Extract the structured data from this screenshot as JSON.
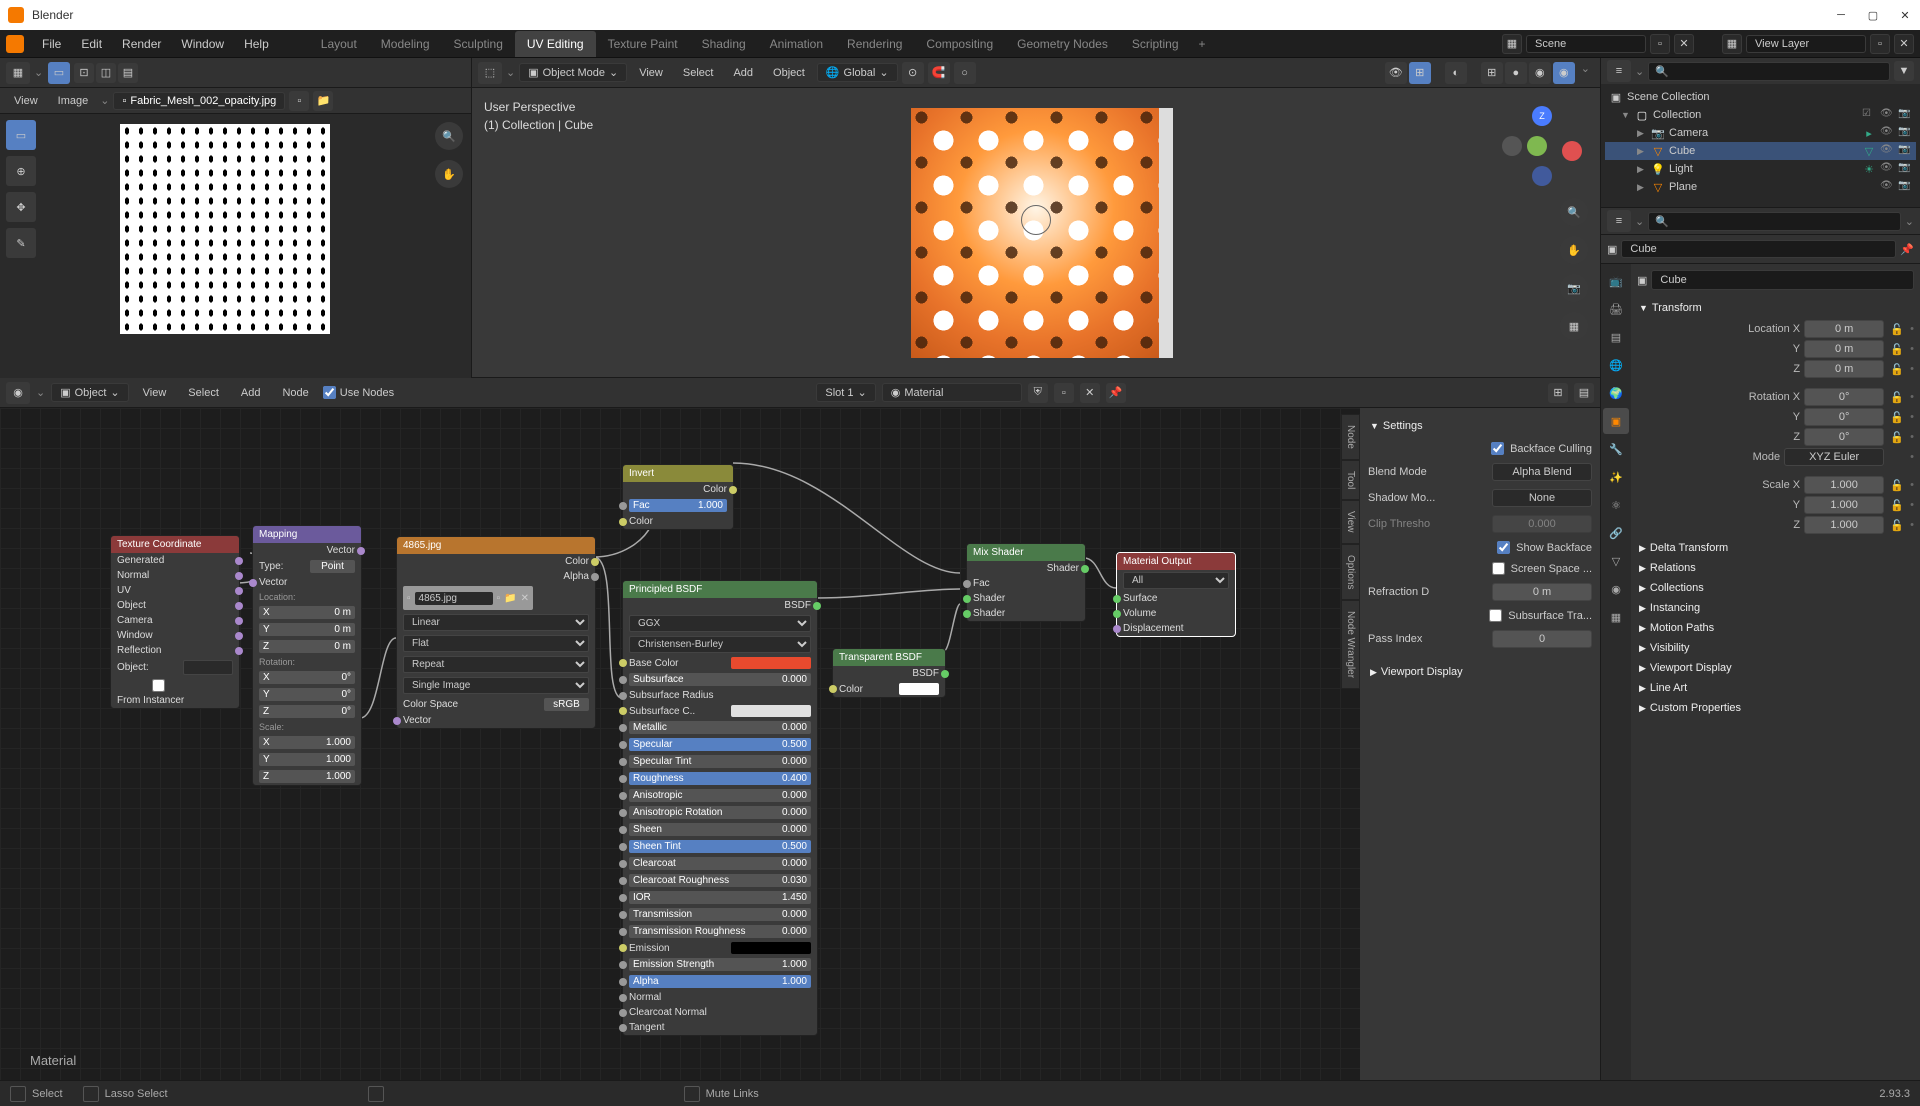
{
  "app": {
    "title": "Blender"
  },
  "topmenu": {
    "items": [
      "File",
      "Edit",
      "Render",
      "Window",
      "Help"
    ],
    "workspaces": [
      "Layout",
      "Modeling",
      "Sculpting",
      "UV Editing",
      "Texture Paint",
      "Shading",
      "Animation",
      "Rendering",
      "Compositing",
      "Geometry Nodes",
      "Scripting"
    ],
    "active_workspace": "UV Editing",
    "scene_label": "Scene",
    "layer_label": "View Layer"
  },
  "uv": {
    "menus": [
      "View",
      "Image"
    ],
    "image_name": "Fabric_Mesh_002_opacity.jpg"
  },
  "viewport": {
    "menus": [
      "View",
      "Select",
      "Add",
      "Object"
    ],
    "mode": "Object Mode",
    "orientation": "Global",
    "info_line1": "User Perspective",
    "info_line2": "(1) Collection | Cube"
  },
  "shader": {
    "menus": [
      "View",
      "Select",
      "Add",
      "Node"
    ],
    "object_label": "Object",
    "use_nodes": "Use Nodes",
    "slot": "Slot 1",
    "material": "Material",
    "material_label": "Material"
  },
  "nodes": {
    "texcoord": {
      "title": "Texture Coordinate",
      "outputs": [
        "Generated",
        "Normal",
        "UV",
        "Object",
        "Camera",
        "Window",
        "Reflection"
      ],
      "object_label": "Object:",
      "instancer": "From Instancer"
    },
    "mapping": {
      "title": "Mapping",
      "type_label": "Type:",
      "type": "Point",
      "vector": "Vector",
      "location": "Location:",
      "rotation": "Rotation:",
      "scale": "Scale:",
      "loc": {
        "x": "0 m",
        "y": "0 m",
        "z": "0 m"
      },
      "rot": {
        "x": "0°",
        "y": "0°",
        "z": "0°"
      },
      "scl": {
        "x": "1.000",
        "y": "1.000",
        "z": "1.000"
      }
    },
    "image": {
      "title": "4865.jpg",
      "name": "4865.jpg",
      "outputs": {
        "color": "Color",
        "alpha": "Alpha"
      },
      "interp": "Linear",
      "proj": "Flat",
      "ext": "Repeat",
      "src": "Single Image",
      "cs_label": "Color Space",
      "cs": "sRGB",
      "vector": "Vector"
    },
    "invert": {
      "title": "Invert",
      "color_out": "Color",
      "fac": "Fac",
      "fac_val": "1.000",
      "color_in": "Color"
    },
    "bsdf": {
      "title": "Principled BSDF",
      "out": "BSDF",
      "dist": "GGX",
      "sss": "Christensen-Burley",
      "rows": [
        {
          "k": "Base Color",
          "v": "",
          "swatch": "#e84a2e"
        },
        {
          "k": "Subsurface",
          "v": "0.000"
        },
        {
          "k": "Subsurface Radius",
          "v": ""
        },
        {
          "k": "Subsurface C..",
          "v": "",
          "swatch": "#e0e0e0"
        },
        {
          "k": "Metallic",
          "v": "0.000"
        },
        {
          "k": "Specular",
          "v": "0.500",
          "blue": true
        },
        {
          "k": "Specular Tint",
          "v": "0.000"
        },
        {
          "k": "Roughness",
          "v": "0.400",
          "blue": true
        },
        {
          "k": "Anisotropic",
          "v": "0.000"
        },
        {
          "k": "Anisotropic Rotation",
          "v": "0.000"
        },
        {
          "k": "Sheen",
          "v": "0.000"
        },
        {
          "k": "Sheen Tint",
          "v": "0.500",
          "blue": true
        },
        {
          "k": "Clearcoat",
          "v": "0.000"
        },
        {
          "k": "Clearcoat Roughness",
          "v": "0.030"
        },
        {
          "k": "IOR",
          "v": "1.450"
        },
        {
          "k": "Transmission",
          "v": "0.000"
        },
        {
          "k": "Transmission Roughness",
          "v": "0.000"
        },
        {
          "k": "Emission",
          "v": "",
          "swatch": "#000"
        },
        {
          "k": "Emission Strength",
          "v": "1.000"
        },
        {
          "k": "Alpha",
          "v": "1.000",
          "blue": true
        },
        {
          "k": "Normal",
          "v": ""
        },
        {
          "k": "Clearcoat Normal",
          "v": ""
        },
        {
          "k": "Tangent",
          "v": ""
        }
      ]
    },
    "transparent": {
      "title": "Transparent BSDF",
      "out": "BSDF",
      "color": "Color"
    },
    "mix": {
      "title": "Mix Shader",
      "out": "Shader",
      "fac": "Fac",
      "s1": "Shader",
      "s2": "Shader"
    },
    "output": {
      "title": "Material Output",
      "target": "All",
      "surface": "Surface",
      "volume": "Volume",
      "disp": "Displacement"
    },
    "sidebar": {
      "settings": "Settings",
      "backface_culling": "Backface Culling",
      "blend_mode": "Blend Mode",
      "blend_val": "Alpha Blend",
      "shadow_mode": "Shadow Mo...",
      "shadow_val": "None",
      "clip_thresh": "Clip Thresho",
      "clip_val": "0.000",
      "show_backface": "Show Backface",
      "screen_space": "Screen Space ...",
      "refraction": "Refraction D",
      "refraction_val": "0 m",
      "sss_trans": "Subsurface Tra...",
      "pass_index": "Pass Index",
      "pass_val": "0",
      "viewport_display": "Viewport Display",
      "tabs": [
        "Node",
        "Tool",
        "View",
        "Options",
        "Node Wrangler"
      ]
    }
  },
  "outliner": {
    "root": "Scene Collection",
    "collection": "Collection",
    "items": [
      "Camera",
      "Cube",
      "Light",
      "Plane"
    ]
  },
  "obj_name": "Cube",
  "obj_data_name": "Cube",
  "transform": {
    "header": "Transform",
    "location": "Location X",
    "loc": {
      "x": "0 m",
      "y": "0 m",
      "z": "0 m"
    },
    "rotation": "Rotation X",
    "rot": {
      "x": "0°",
      "y": "0°",
      "z": "0°"
    },
    "mode": "Mode",
    "mode_val": "XYZ Euler",
    "scale": "Scale X",
    "scl": {
      "x": "1.000",
      "y": "1.000",
      "z": "1.000"
    },
    "sections": [
      "Delta Transform",
      "Relations",
      "Collections",
      "Instancing",
      "Motion Paths",
      "Visibility",
      "Viewport Display",
      "Line Art",
      "Custom Properties"
    ]
  },
  "status": {
    "select": "Select",
    "lasso": "Lasso Select",
    "mute": "Mute Links",
    "version": "2.93.3"
  }
}
